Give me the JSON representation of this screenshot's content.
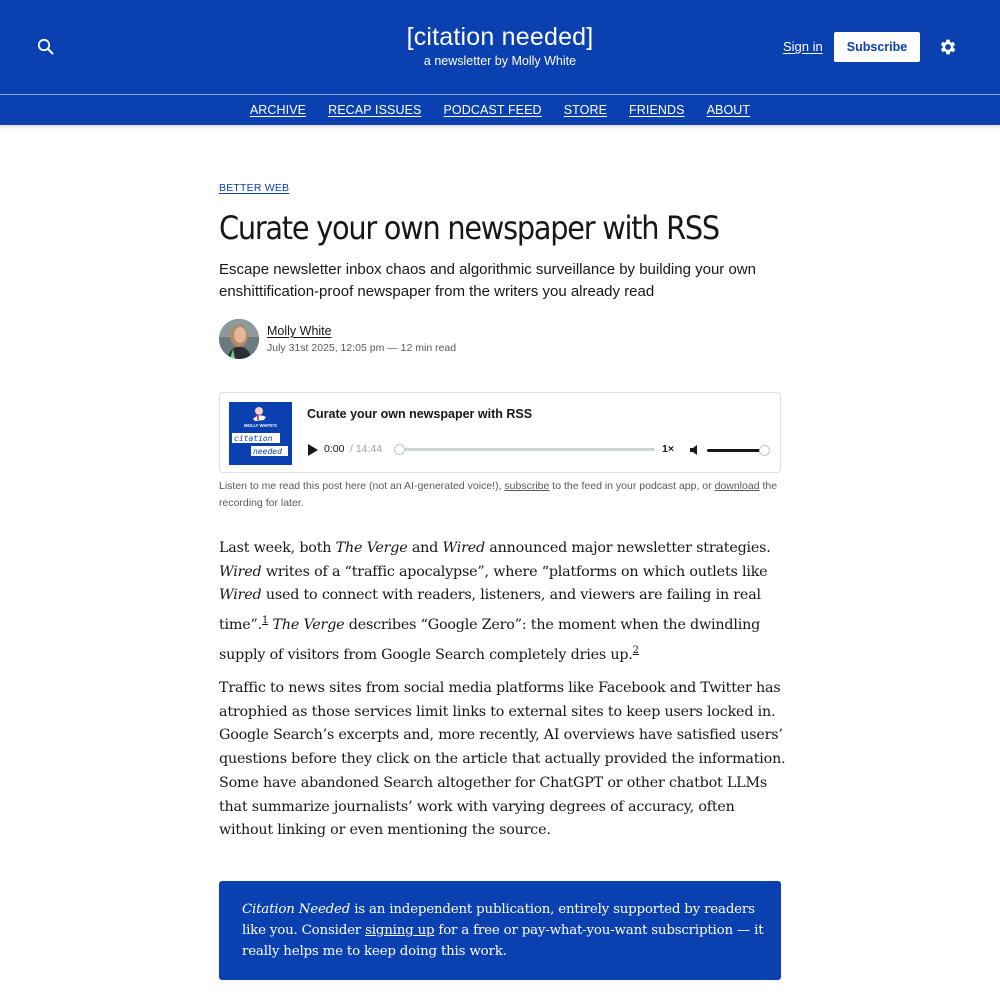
{
  "header": {
    "site_title": "[citation needed]",
    "site_subtitle": "a newsletter by Molly White",
    "signin_label": "Sign in",
    "subscribe_label": "Subscribe",
    "brand_color": "#0a40b0"
  },
  "nav": {
    "items": [
      {
        "label": "ARCHIVE"
      },
      {
        "label": "RECAP ISSUES"
      },
      {
        "label": "PODCAST FEED"
      },
      {
        "label": "STORE"
      },
      {
        "label": "FRIENDS"
      },
      {
        "label": "ABOUT"
      }
    ]
  },
  "article": {
    "tag": "BETTER WEB",
    "title": "Curate your own newspaper with RSS",
    "excerpt": "Escape newsletter inbox chaos and algorithmic surveillance by building your own enshittification-proof newspaper from the writers you already read",
    "author": "Molly White",
    "meta": "July 31st 2025, 12:05 pm — 12 min read"
  },
  "player": {
    "title": "Curate your own newspaper with RSS",
    "current_time": "0:00",
    "duration": "/ 14:44",
    "speed": "1×",
    "progress": 0,
    "volume": 1.0,
    "art_small_text": "MOLLY WHITE'S",
    "art_line1": "citation",
    "art_line2": "needed"
  },
  "caption": {
    "before": "Listen to me read this post here (not an AI-generated voice!), ",
    "link1": "subscribe",
    "middle": " to the feed in your podcast app, or ",
    "link2": "download",
    "after": " the recording for later."
  },
  "body": {
    "p1": {
      "s1": "Last week, both ",
      "i1": "The Verge",
      "s2": " and ",
      "i2": "Wired",
      "s3": " announced major newsletter strategies. ",
      "i3": "Wired",
      "s4": " writes of a “traffic apocalypse”, where “platforms on which outlets like ",
      "i4": "Wired",
      "s5": " used to connect with readers, listeners, and viewers are failing in real time”.",
      "fn1": "1",
      "s6": " ",
      "i5": "The Verge",
      "s7": " describes “Google Zero”: the moment when the dwindling supply of visitors from Google Search completely dries up.",
      "fn2": "2"
    },
    "p2": "Traffic to news sites from social media platforms like Facebook and Twitter has atrophied as those services limit links to external sites to keep users locked in. Google Search’s excerpts and, more recently, AI overviews have satisfied users’ questions before they click on the article that actually provided the information. Some have abandoned Search altogether for ChatGPT or other chatbot LLMs that summarize journalists’ work with varying degrees of accuracy, often without linking or even mentioning the source."
  },
  "support": {
    "pub_name": "Citation Needed",
    "s1": " is an independent publication, entirely supported by readers like you. Consider ",
    "link": "signing up",
    "s2": " for a free or pay-what-you-want subscription — it really helps me to keep doing this work."
  }
}
